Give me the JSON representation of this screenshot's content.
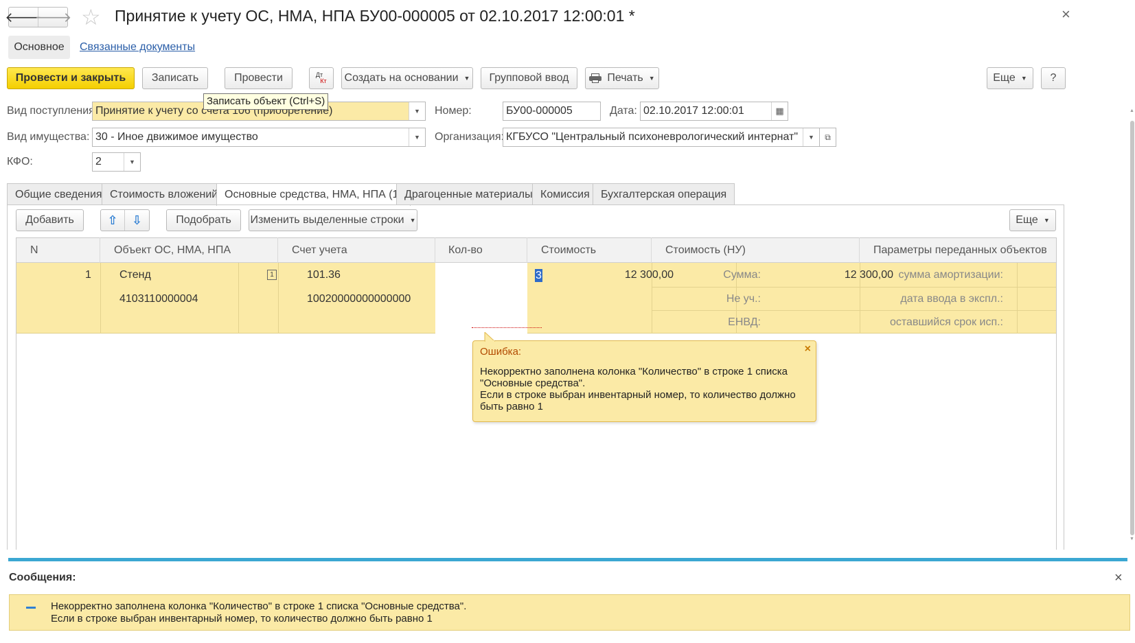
{
  "window": {
    "title": "Принятие к учету ОС, НМА, НПА БУ00-000005 от 02.10.2017 12:00:01 *",
    "close_glyph": "×"
  },
  "nav": {
    "tabs": [
      "Основное",
      "Связанные документы"
    ]
  },
  "toolbar": {
    "post_close": "Провести и закрыть",
    "save": "Записать",
    "post": "Провести",
    "dt_label": "Дт",
    "kt_label": "Кт",
    "create_based": "Создать на основании",
    "group_input": "Групповой ввод",
    "print": "Печать",
    "more": "Еще",
    "help": "?"
  },
  "tooltip": "Записать объект (Ctrl+S)",
  "form": {
    "receipt_type_label": "Вид поступления:",
    "receipt_type_value": "Принятие к учету со счета 106 (приобретение)",
    "number_label": "Номер:",
    "number_value": "БУ00-000005",
    "date_label": "Дата:",
    "date_value": "02.10.2017 12:00:01",
    "property_label": "Вид имущества:",
    "property_value": "30 - Иное движимое имущество",
    "org_label": "Организация:",
    "org_value": "КГБУСО \"Центральный психоневрологический интернат\"",
    "kfo_label": "КФО:",
    "kfo_value": "2"
  },
  "tabs": [
    "Общие сведения",
    "Стоимость вложений",
    "Основные средства, НМА, НПА (1)",
    "Драгоценные материалы",
    "Комиссия",
    "Бухгалтерская операция"
  ],
  "table_toolbar": {
    "add": "Добавить",
    "pick": "Подобрать",
    "change_rows": "Изменить выделенные строки",
    "more": "Еще"
  },
  "table": {
    "headers": [
      "N",
      "Объект ОС, НМА, НПА",
      "Счет учета",
      "Кол-во",
      "Стоимость",
      "Стоимость (НУ)",
      "Параметры переданных объектов"
    ],
    "row": {
      "n": "1",
      "object": "Стенд",
      "inventory": "4103110000004",
      "account": "101.36",
      "account_sub": "10020000000000000",
      "qty": "3",
      "cost": "12 300,00",
      "nu_labels": [
        "Сумма:",
        "Не уч.:",
        "ЕНВД:"
      ],
      "nu_sum": "12 300,00",
      "param_labels": [
        "сумма амортизации:",
        "дата ввода в экспл.:",
        "оставшийся срок исп.:"
      ]
    }
  },
  "error_popup": {
    "title": "Ошибка:",
    "line1": "Некорректно заполнена колонка \"Количество\" в строке 1 списка",
    "line2": "\"Основные средства\".",
    "line3": "Если в строке выбран инвентарный номер, то количество должно",
    "line4": "быть равно 1"
  },
  "messages": {
    "title": "Сообщения:",
    "line1": "Некорректно заполнена колонка \"Количество\" в строке 1 списка \"Основные средства\".",
    "line2": "Если в строке выбран инвентарный номер, то количество должно быть равно 1"
  },
  "colors": {
    "accent_yellow": "#f4cf00",
    "row_highlight": "#fbeaa6",
    "message_bar": "#3ba7d2",
    "link_blue": "#2a5ea8"
  }
}
